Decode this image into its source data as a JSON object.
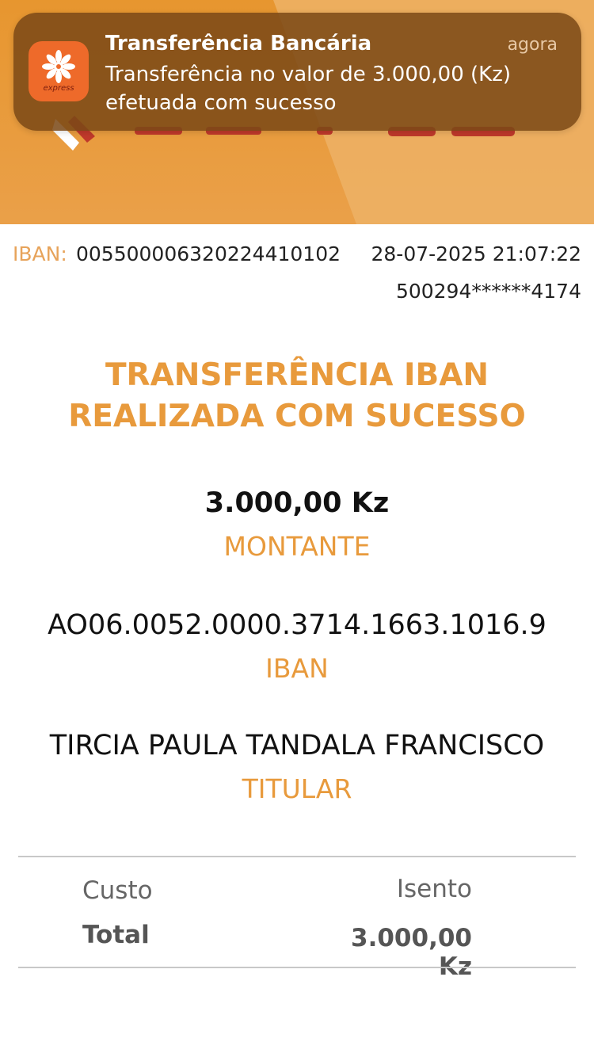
{
  "notification": {
    "app_name": "Transferência Bancária",
    "time": "agora",
    "message": "Transferência no valor de 3.000,00 (Kz) efetuada com sucesso",
    "icon": "express-app-icon",
    "icon_text": "express"
  },
  "receipt": {
    "iban_label": "IBAN:",
    "iban_value": "005500006320224410102",
    "datetime": "28-07-2025 21:07:22",
    "card_number": "500294******4174",
    "headline_line1": "TRANSFERÊNCIA IBAN",
    "headline_line2": "REALIZADA COM SUCESSO",
    "amount": "3.000,00 Kz",
    "amount_label": "MONTANTE",
    "beneficiary_iban": "AO06.0052.0000.3714.1663.1016.9",
    "beneficiary_iban_label": "IBAN",
    "holder": "TIRCIA PAULA TANDALA FRANCISCO",
    "holder_label": "TITULAR"
  },
  "summary": {
    "cost_label": "Custo",
    "cost_value": "Isento",
    "total_label": "Total",
    "total_value": "3.000,00 Kz"
  },
  "colors": {
    "accent": "#e89a3c",
    "header": "#e7962f",
    "notification_bg": "#7a4816"
  }
}
